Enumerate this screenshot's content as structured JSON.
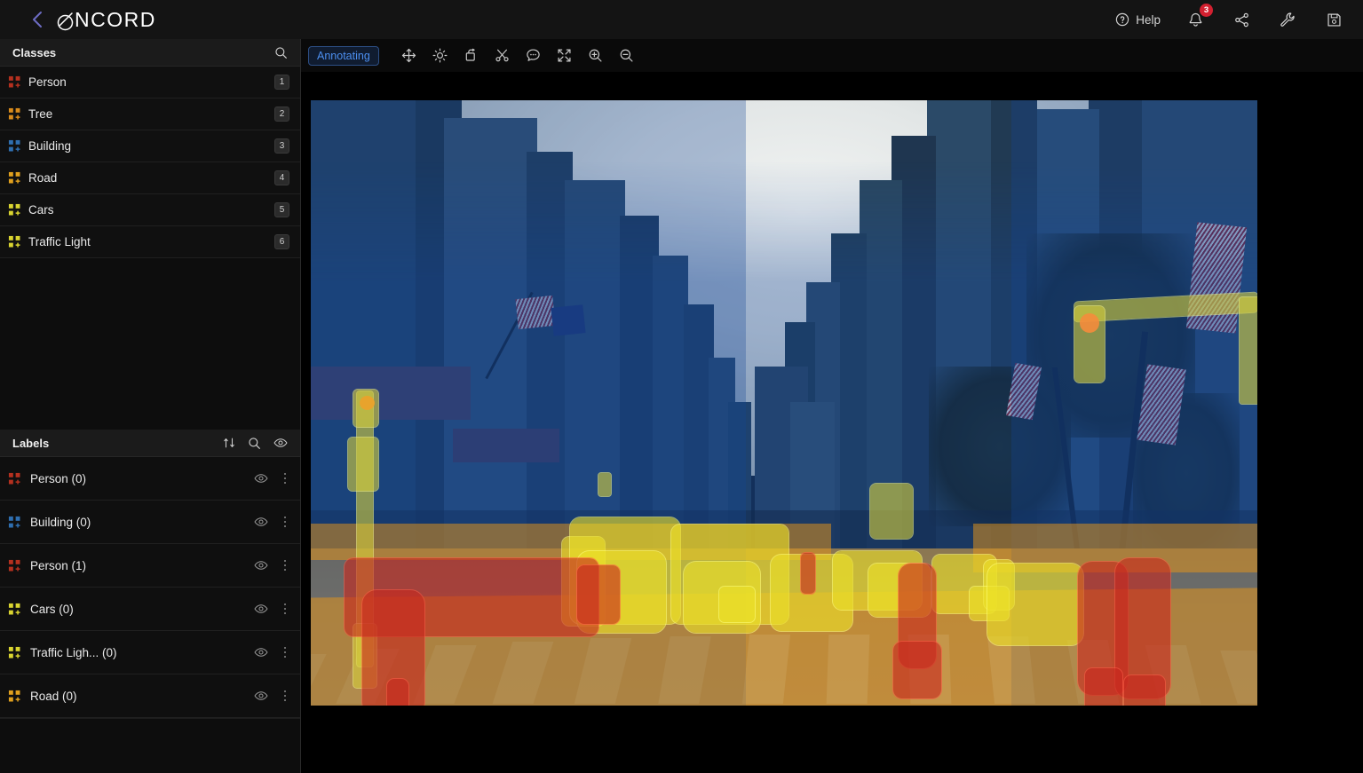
{
  "app": {
    "brand": "NCORD",
    "brand_full": "ENCORD"
  },
  "topbar": {
    "back_label": "back",
    "help_label": "Help",
    "notifications_count": "3",
    "icons": [
      "help-circle-icon",
      "bell-icon",
      "share-icon",
      "wrench-icon",
      "save-icon"
    ]
  },
  "toolbar": {
    "mode_label": "Annotating",
    "tools": [
      {
        "name": "move-tool",
        "icon": "move-arrows-icon"
      },
      {
        "name": "brightness-tool",
        "icon": "brightness-sun-icon"
      },
      {
        "name": "rotate-tool",
        "icon": "rotate-square-icon"
      },
      {
        "name": "cut-tool",
        "icon": "scissors-icon"
      },
      {
        "name": "comment-tool",
        "icon": "speech-bubble-icon"
      },
      {
        "name": "fullscreen-tool",
        "icon": "expand-arrows-icon"
      },
      {
        "name": "zoom-in-tool",
        "icon": "zoom-in-icon"
      },
      {
        "name": "zoom-out-tool",
        "icon": "zoom-out-icon"
      }
    ]
  },
  "classes_panel": {
    "title": "Classes",
    "search_icon": "search-icon",
    "items": [
      {
        "label": "Person",
        "shortcut": "1",
        "color": "#b5301f"
      },
      {
        "label": "Tree",
        "shortcut": "2",
        "color": "#d98b1c"
      },
      {
        "label": "Building",
        "shortcut": "3",
        "color": "#2f6fb0"
      },
      {
        "label": "Road",
        "shortcut": "4",
        "color": "#e0a01e"
      },
      {
        "label": "Cars",
        "shortcut": "5",
        "color": "#d9d430"
      },
      {
        "label": "Traffic Light",
        "shortcut": "6",
        "color": "#d9d430"
      }
    ]
  },
  "labels_panel": {
    "title": "Labels",
    "actions": [
      "sort-icon",
      "search-icon",
      "eye-icon"
    ],
    "items": [
      {
        "label": "Person (0)",
        "color": "#b5301f"
      },
      {
        "label": "Building (0)",
        "color": "#2f6fb0"
      },
      {
        "label": "Person (1)",
        "color": "#b5301f"
      },
      {
        "label": "Cars (0)",
        "color": "#d9d430"
      },
      {
        "label": "Traffic Ligh... (0)",
        "color": "#d9d430"
      },
      {
        "label": "Road (0)",
        "color": "#e0a01e"
      }
    ]
  },
  "canvas": {
    "name": "annotation-canvas",
    "description": "City street scene with semantic segmentation masks"
  },
  "colors": {
    "accent_blue": "#4c8ff0",
    "badge_red": "#d32030",
    "panel_bg": "#0d0d0d",
    "header_bg": "#141414",
    "mask_person": "#c8281e",
    "mask_cars": "#ebe128",
    "mask_road": "#e69619",
    "mask_building": "#1446 96"
  }
}
